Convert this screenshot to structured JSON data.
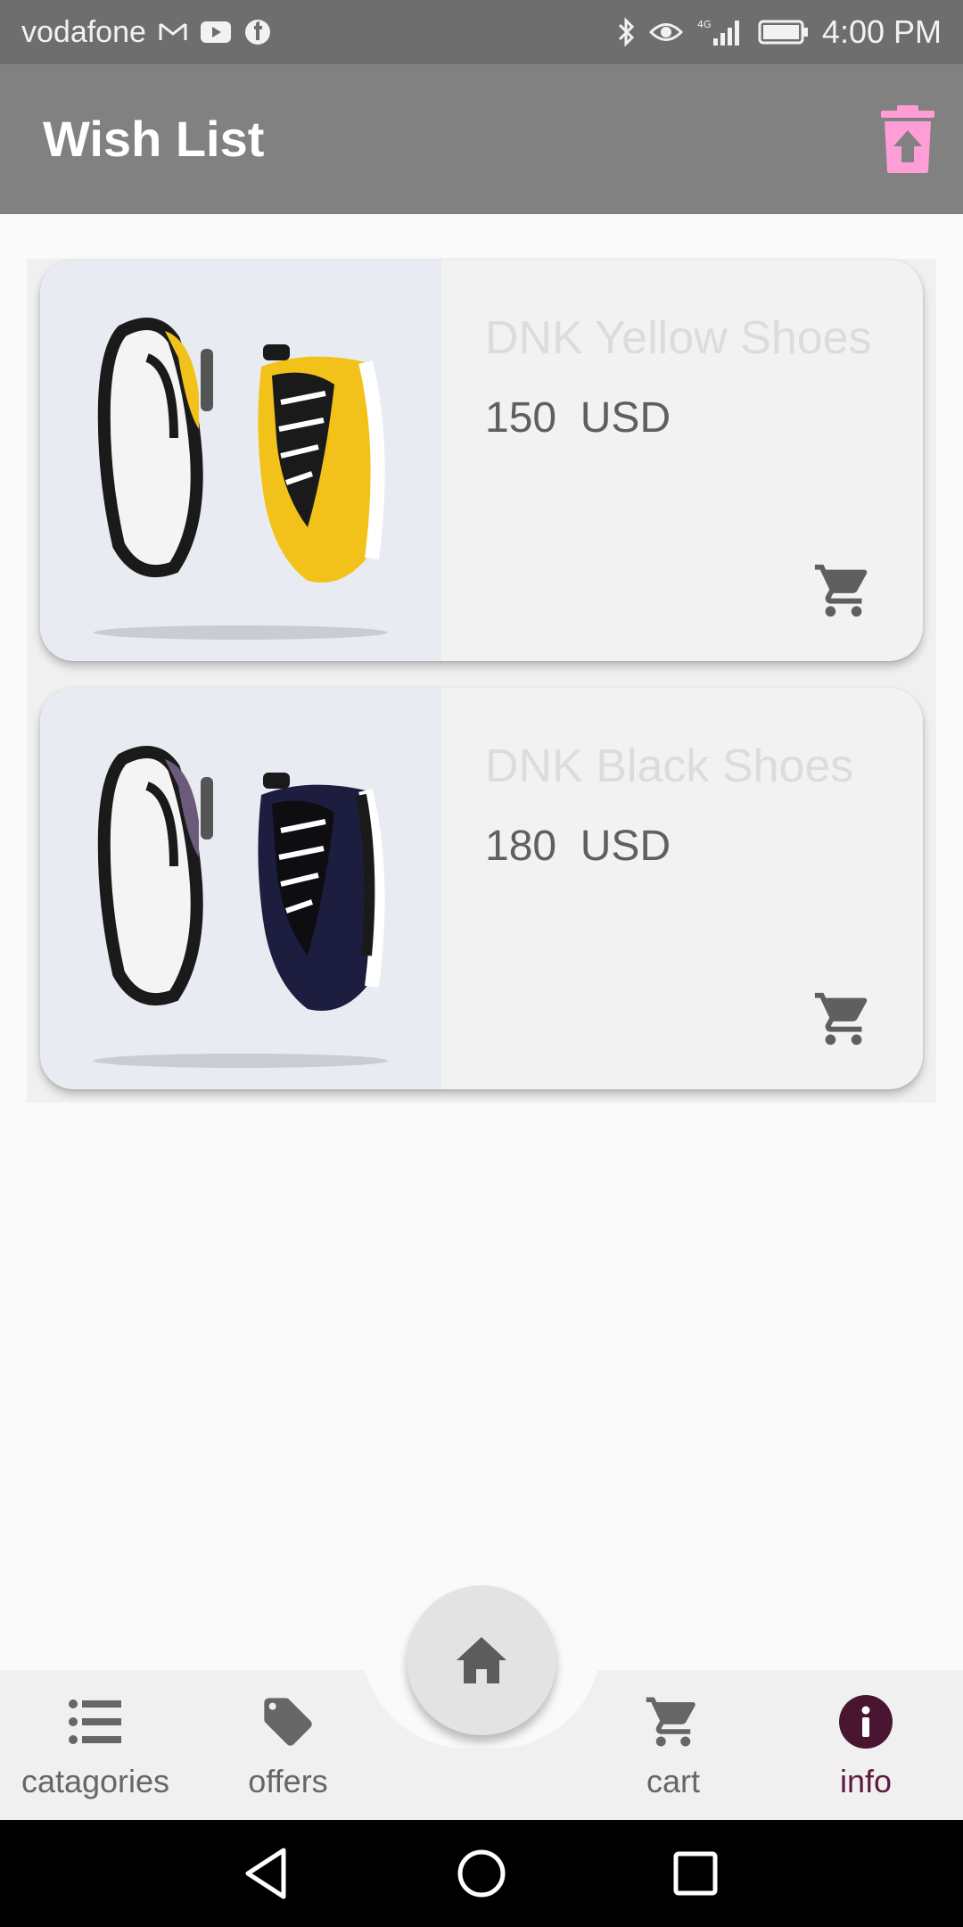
{
  "status_bar": {
    "carrier": "vodafone",
    "time": "4:00 PM",
    "network": "4G",
    "icons": [
      "gmail-icon",
      "youtube-icon",
      "facebook-icon",
      "bluetooth-icon",
      "eye-comfort-icon",
      "signal-icon",
      "battery-icon"
    ]
  },
  "app_bar": {
    "title": "Wish List",
    "clear_icon": "delete-all-icon",
    "accent": "#ff9ed6"
  },
  "wishlist": [
    {
      "name": "DNK Yellow Shoes",
      "price": "150  USD",
      "image": "yellow-sneakers",
      "shoe_color": "#f2c21a"
    },
    {
      "name": "DNK Black Shoes",
      "price": "180  USD",
      "image": "black-sneakers",
      "shoe_color": "#1c1d3f"
    }
  ],
  "bottom_nav": {
    "items": [
      {
        "label": "catagories",
        "icon": "list-icon"
      },
      {
        "label": "offers",
        "icon": "tag-icon"
      },
      {
        "label": "cart",
        "icon": "cart-icon"
      },
      {
        "label": "info",
        "icon": "info-icon",
        "active": true
      }
    ],
    "home_icon": "home-icon",
    "active_color": "#5b1a3f"
  }
}
